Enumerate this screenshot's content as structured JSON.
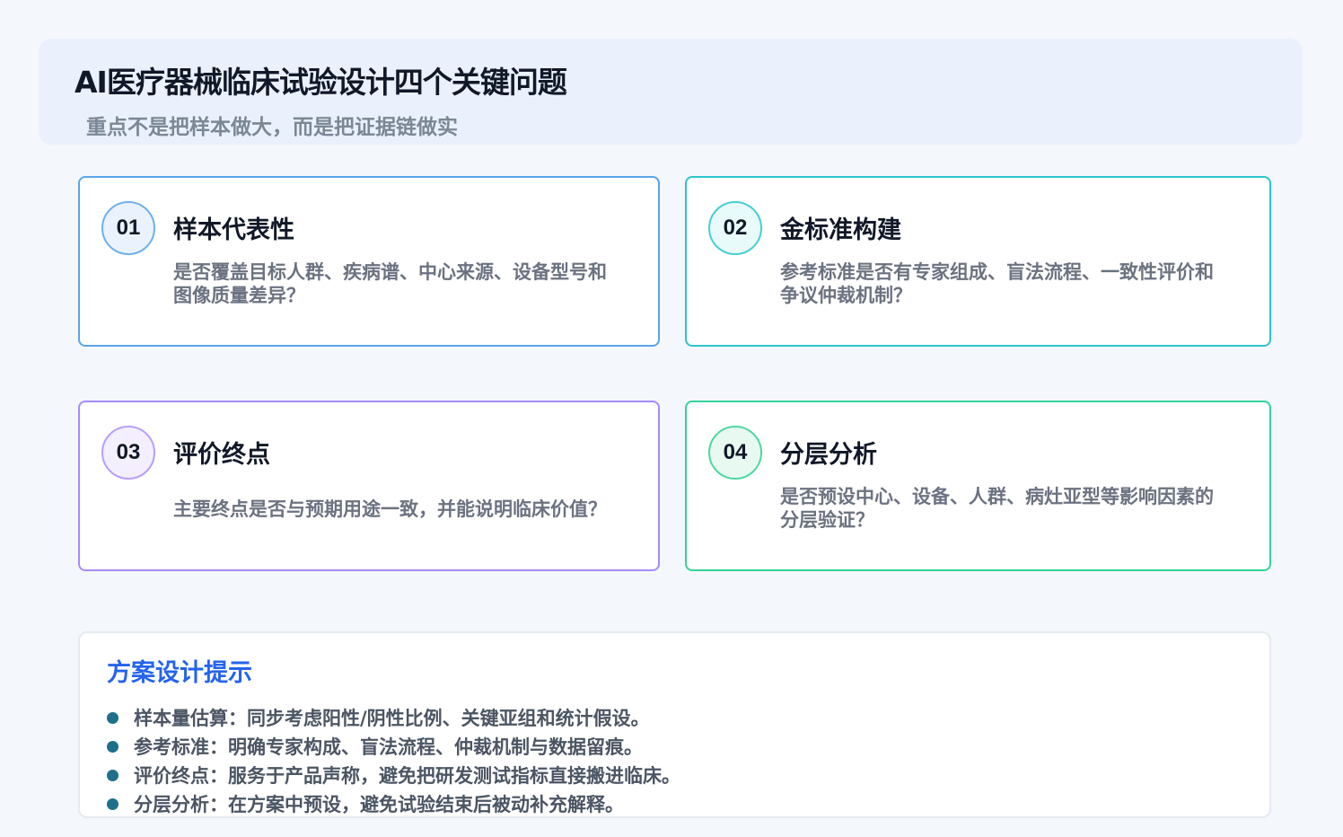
{
  "header": {
    "title": "AI医疗器械临床试验设计四个关键问题",
    "subtitle": "重点不是把样本做大，而是把证据链做实"
  },
  "cards": [
    {
      "number": "01",
      "title": "样本代表性",
      "description": "是否覆盖目标人群、疾病谱、中心来源、设备型号和图像质量差异？",
      "color": "#5aa4ec"
    },
    {
      "number": "02",
      "title": "金标准构建",
      "description": "参考标准是否有专家组成、盲法流程、一致性评价和争议仲裁机制？",
      "color": "#2ec5cc"
    },
    {
      "number": "03",
      "title": "评价终点",
      "description": "主要终点是否与预期用途一致，并能说明临床价值？",
      "color": "#a78bfa"
    },
    {
      "number": "04",
      "title": "分层分析",
      "description": "是否预设中心、设备、人群、病灶亚型等影响因素的分层验证？",
      "color": "#34d399"
    }
  ],
  "tips": {
    "title": "方案设计提示",
    "title_color": "#2563eb",
    "bullet_color": "#1f6f8b",
    "items": [
      "样本量估算：同步考虑阳性/阴性比例、关键亚组和统计假设。",
      "参考标准：明确专家构成、盲法流程、仲裁机制与数据留痕。",
      "评价终点：服务于产品声称，避免把研发测试指标直接搬进临床。",
      "分层分析：在方案中预设，避免试验结束后被动补充解释。"
    ]
  }
}
